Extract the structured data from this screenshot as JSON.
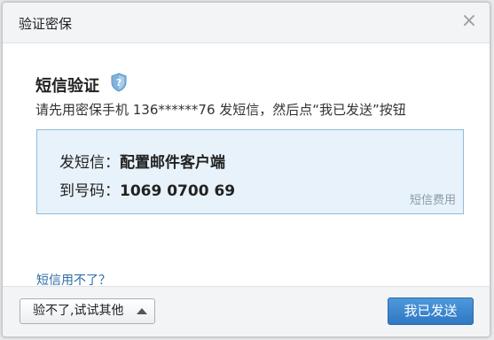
{
  "dialog": {
    "title": "验证密保",
    "close_glyph": "×"
  },
  "content": {
    "heading": "短信验证",
    "instruction": "请先用密保手机 136******76 发短信，然后点“我已发送”按钮",
    "sms_box": {
      "send_label": "发短信：",
      "send_value": "配置邮件客户端",
      "number_label": "到号码：",
      "number_value": "1069 0700 69",
      "fee_link": "短信费用"
    },
    "help_link": "短信用不了？"
  },
  "footer": {
    "alt_button": "验不了,试试其他",
    "send_button": "我已发送"
  },
  "colors": {
    "primary": "#3a84cf",
    "link": "#2e6ca8",
    "box_bg": "#e8f2fa",
    "box_border": "#8fbcdc"
  }
}
